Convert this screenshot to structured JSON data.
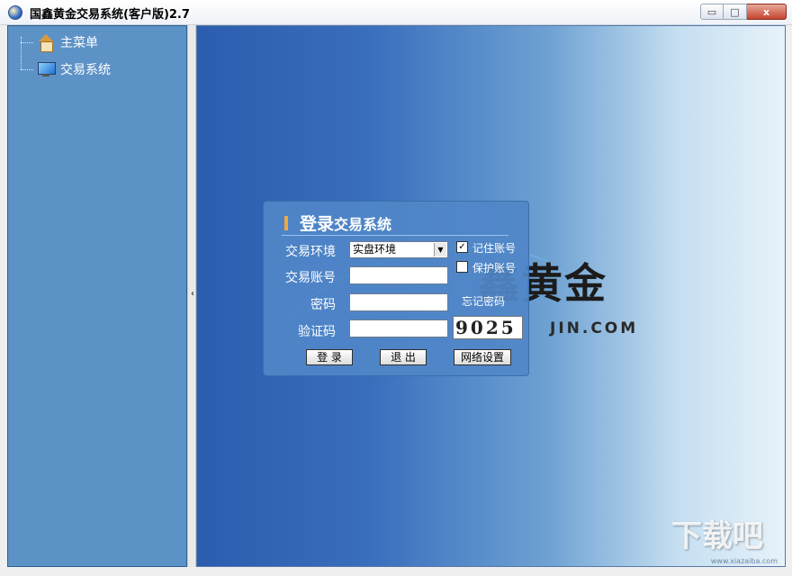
{
  "window": {
    "title": "国鑫黄金交易系统(客户版)2.7",
    "min_glyph": "▭",
    "max_glyph": "□",
    "close_glyph": "x"
  },
  "sidebar": {
    "items": [
      {
        "label": "主菜单",
        "icon": "house-icon"
      },
      {
        "label": "交易系统",
        "icon": "monitor-icon"
      }
    ]
  },
  "splitter": {
    "glyph": "‹"
  },
  "brand": {
    "logo_text": "鑫黄金",
    "logo_sub": "JIN.COM",
    "watermark": "下载吧",
    "watermark_sub": "www.xiazaiba.com"
  },
  "login": {
    "title_big": "登录",
    "title_small": "交易系统",
    "env_label": "交易环境",
    "env_value": "实盘环境",
    "account_label": "交易账号",
    "account_value": "",
    "password_label": "密码",
    "password_value": "",
    "captcha_label": "验证码",
    "captcha_value": "",
    "captcha_image_text": "9025",
    "remember_label": "记住账号",
    "remember_checked": true,
    "protect_label": "保护账号",
    "protect_checked": false,
    "forgot_label": "忘记密码",
    "login_button": "登 录",
    "exit_button": "退 出",
    "network_button": "网络设置",
    "checkmark": "✓"
  }
}
